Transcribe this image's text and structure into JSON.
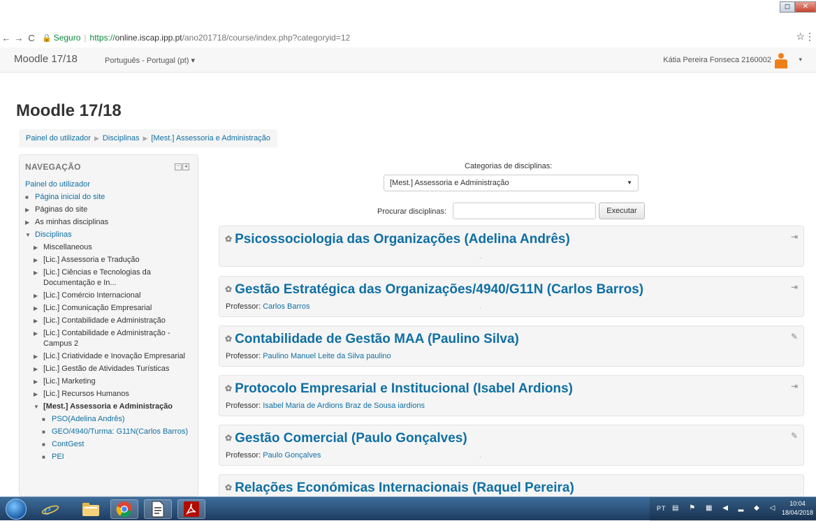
{
  "browser": {
    "back_icon": "arrow-left",
    "forward_icon": "arrow-right",
    "reload_icon": "reload",
    "secure_label": "Seguro",
    "url_scheme": "https://",
    "url_host": "online.iscap.ipp.pt",
    "url_path": "/ano201718/course/index.php?categoryid=12",
    "bookmark_icon": "star",
    "menu_icon": "kebab"
  },
  "navbar": {
    "brand": "Moodle 17/18",
    "language": "Português - Portugal (pt) ▾",
    "user_name": "Kátia Pereira Fonseca 2160002",
    "user_caret": "▾"
  },
  "page": {
    "title": "Moodle 17/18",
    "breadcrumb": [
      "Painel do utilizador",
      "Disciplinas",
      "[Mest.] Assessoria e Administração"
    ]
  },
  "sidebar": {
    "title": "NAVEGAÇÃO",
    "root": "Painel do utilizador",
    "items": [
      {
        "label": "Página inicial do site",
        "marker": "■"
      },
      {
        "label": "Páginas do site",
        "marker": "▶"
      },
      {
        "label": "As minhas disciplinas",
        "marker": "▶"
      },
      {
        "label": "Disciplinas",
        "marker": "▼"
      },
      {
        "label": "Miscellaneous",
        "marker": "▶"
      },
      {
        "label": "[Lic.] Assessoria e Tradução",
        "marker": "▶"
      },
      {
        "label": "[Lic.] Ciências e Tecnologias da Documentação e In...",
        "marker": "▶"
      },
      {
        "label": "[Lic.] Comércio Internacional",
        "marker": "▶"
      },
      {
        "label": "[Lic.] Comunicação Empresarial",
        "marker": "▶"
      },
      {
        "label": "[Lic.] Contabilidade e Administração",
        "marker": "▶"
      },
      {
        "label": "[Lic.] Contabilidade e Administração - Campus 2",
        "marker": "▶"
      },
      {
        "label": "[Lic.] Criatividade e Inovação Empresarial",
        "marker": "▶"
      },
      {
        "label": "[Lic.] Gestão de Atividades Turísticas",
        "marker": "▶"
      },
      {
        "label": "[Lic.] Marketing",
        "marker": "▶"
      },
      {
        "label": "[Lic.] Recursos Humanos",
        "marker": "▶"
      },
      {
        "label": "[Mest.] Assessoria e Administração",
        "marker": "▼"
      },
      {
        "label": "PSO(Adelina Andrês)",
        "marker": "■"
      },
      {
        "label": "GEO/4940/Turma: G11N(Carlos Barros)",
        "marker": "■"
      },
      {
        "label": "ContGest",
        "marker": "■"
      },
      {
        "label": "PEI",
        "marker": "■"
      }
    ]
  },
  "main": {
    "category_label": "Categorias de disciplinas:",
    "category_selected": "[Mest.] Assessoria e Administração",
    "search_label": "Procurar disciplinas:",
    "search_placeholder": "",
    "search_button": "Executar",
    "teacher_label": "Professor:",
    "courses": [
      {
        "title": "Psicossociologia das Organizações (Adelina Andrês)",
        "professor": ""
      },
      {
        "title": "Gestão Estratégica das Organizações/4940/G11N (Carlos Barros)",
        "professor": "Carlos Barros"
      },
      {
        "title": "Contabilidade de Gestão MAA (Paulino Silva)",
        "professor": "Paulino Manuel Leite da Silva paulino"
      },
      {
        "title": "Protocolo Empresarial e Institucional (Isabel Ardions)",
        "professor": "Isabel Maria de Ardions Braz de Sousa iardions"
      },
      {
        "title": "Gestão Comercial (Paulo Gonçalves)",
        "professor": "Paulo Gonçalves"
      },
      {
        "title": "Relações Económicas Internacionais (Raquel Pereira)",
        "professor": ""
      }
    ]
  },
  "taskbar": {
    "tray_lang": "PT",
    "time": "10:04",
    "date": "18/04/2018"
  }
}
